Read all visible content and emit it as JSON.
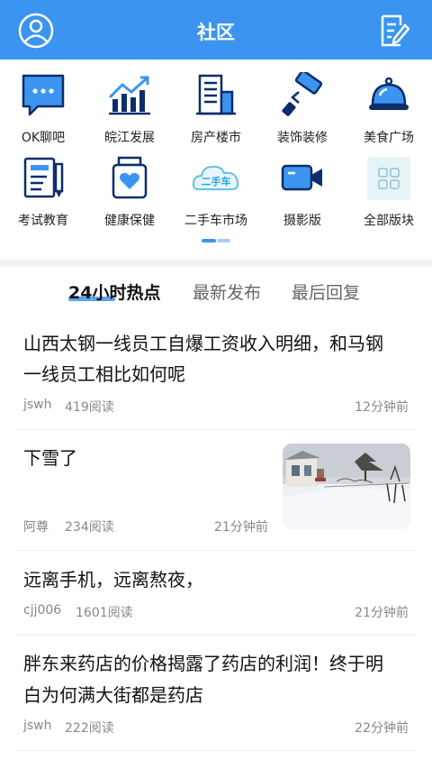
{
  "header": {
    "title": "社区"
  },
  "categories": [
    {
      "label": "OK聊吧",
      "icon": "chat-bubble-icon"
    },
    {
      "label": "皖江发展",
      "icon": "growth-chart-icon"
    },
    {
      "label": "房产楼市",
      "icon": "building-icon"
    },
    {
      "label": "装饰装修",
      "icon": "paint-roller-icon"
    },
    {
      "label": "美食广场",
      "icon": "food-cloche-icon"
    },
    {
      "label": "考试教育",
      "icon": "exam-notebook-icon"
    },
    {
      "label": "健康保健",
      "icon": "health-jar-icon"
    },
    {
      "label": "二手车市场",
      "icon": "second-hand-car-icon",
      "icon_text": "二手车"
    },
    {
      "label": "摄影版",
      "icon": "video-camera-icon"
    },
    {
      "label": "全部版块",
      "icon": "all-sections-grid-icon"
    }
  ],
  "tabs": [
    {
      "label": "24小时热点",
      "active": true
    },
    {
      "label": "最新发布",
      "active": false
    },
    {
      "label": "最后回复",
      "active": false
    }
  ],
  "posts": [
    {
      "title_line1": "山西太钢一线员工自爆工资收入明细，和马钢",
      "title_line2": "一线员工相比如何呢",
      "author": "jswh",
      "reads": "419阅读",
      "time": "12分钟前"
    },
    {
      "title_line1": "下雪了",
      "author": "阿尊",
      "reads": "234阅读",
      "time": "21分钟前",
      "has_image": true
    },
    {
      "title_line1": "远离手机，远离熬夜，",
      "author": "cjj006",
      "reads": "1601阅读",
      "time": "21分钟前"
    },
    {
      "title_line1": "胖东来药店的价格揭露了药店的利润！终于明",
      "title_line2": "白为何满大街都是药店",
      "author": "jswh",
      "reads": "222阅读",
      "time": "22分钟前"
    }
  ],
  "colors": {
    "primary": "#3b95f0",
    "dark_navy": "#0d2d6b"
  }
}
